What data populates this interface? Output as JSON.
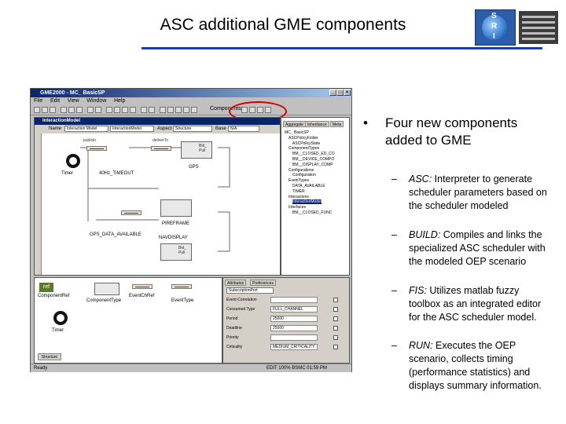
{
  "slide": {
    "title": "ASC additional GME components",
    "bullet": "Four new components added to GME",
    "sub_bullets": [
      {
        "lead": "ASC:",
        "text": " Interpreter to generate scheduler parameters based on the scheduler modeled"
      },
      {
        "lead": "BUILD:",
        "text": " Compiles and links the specialized ASC scheduler with the modeled OEP scenario"
      },
      {
        "lead": "FIS:",
        "text": " Utilizes matlab fuzzy toolbox as an integrated editor for the ASC scheduler model."
      },
      {
        "lead": "RUN:",
        "text": " Executes the OEP scenario, collects timing (performance statistics) and displays summary information."
      }
    ],
    "bullet_glyph": "•",
    "dash_glyph": "–",
    "logo_letters": [
      "S",
      "R",
      "I"
    ]
  },
  "gme": {
    "window_title": "GME2000 - MC_ BasicSP",
    "menu": [
      "File",
      "Edit",
      "View",
      "Window",
      "Help"
    ],
    "components_label": "Components:",
    "model_title": "InteractionModel",
    "header": {
      "name_label": "Name",
      "name_value": "Interaction Model",
      "kind_value": "InteractionModel",
      "aspect_label": "Aspect",
      "aspect_value": "Structure",
      "base_label": "Base",
      "base_value": "N/A"
    },
    "model_labels": {
      "timer": "Timer",
      "hz_timeout": "40Hz_TIMEOUT",
      "gps": "GPS",
      "pireframe": "PIREFRAME",
      "gps_data": "GPS_DATA_AVAILABLE",
      "navdisplay": "NAVDISPLAY",
      "publish": "publish",
      "deliverto": "deliverTo",
      "bld_pull": "Bld_ Pull",
      "bld_pull_2": "Bld_ Pull"
    },
    "right_tabs": [
      "Aggregate",
      "Inheritance",
      "Meta"
    ],
    "tree": [
      "MC_ BasicSP",
      "ASCPolicyFolder",
      "ASCPolicyState",
      "ComponentTypes",
      "BM__CLOSED_ED_CO",
      "BM__DEVICE_COMPO",
      "BM__DISPLAY_COMP",
      "Configurations",
      "Configuration",
      "EventTypes",
      "DATA_AVAILABLE",
      "TIMER",
      "Interactions",
      "InteractionModel",
      "Interfaces",
      "BM__CLOSED_FUNC"
    ],
    "parts": {
      "ref_tile": "ref",
      "component_ref": "ComponentRef",
      "component_type": "ComponentType",
      "event_ch_ref": "EventChRef",
      "event_type": "EventType",
      "timer": "Timer",
      "structure_tab": "Structure"
    },
    "attributes": {
      "tabs": [
        "Attributes",
        "Preferences"
      ],
      "port_name": "SubscriptionPort",
      "rows": [
        {
          "key": "Event Correlation",
          "value": ""
        },
        {
          "key": "Consumed Type",
          "value": "FULL_CHANNEL"
        },
        {
          "key": "Period",
          "value": "25000"
        },
        {
          "key": "Deadline",
          "value": "25000"
        },
        {
          "key": "Priority",
          "value": ""
        },
        {
          "key": "Criticality",
          "value": "MEDIUM_CRITICALITY"
        }
      ]
    },
    "status_left": "Ready",
    "status_right": "EDIT  100%  BSMC  01:59 PM"
  }
}
